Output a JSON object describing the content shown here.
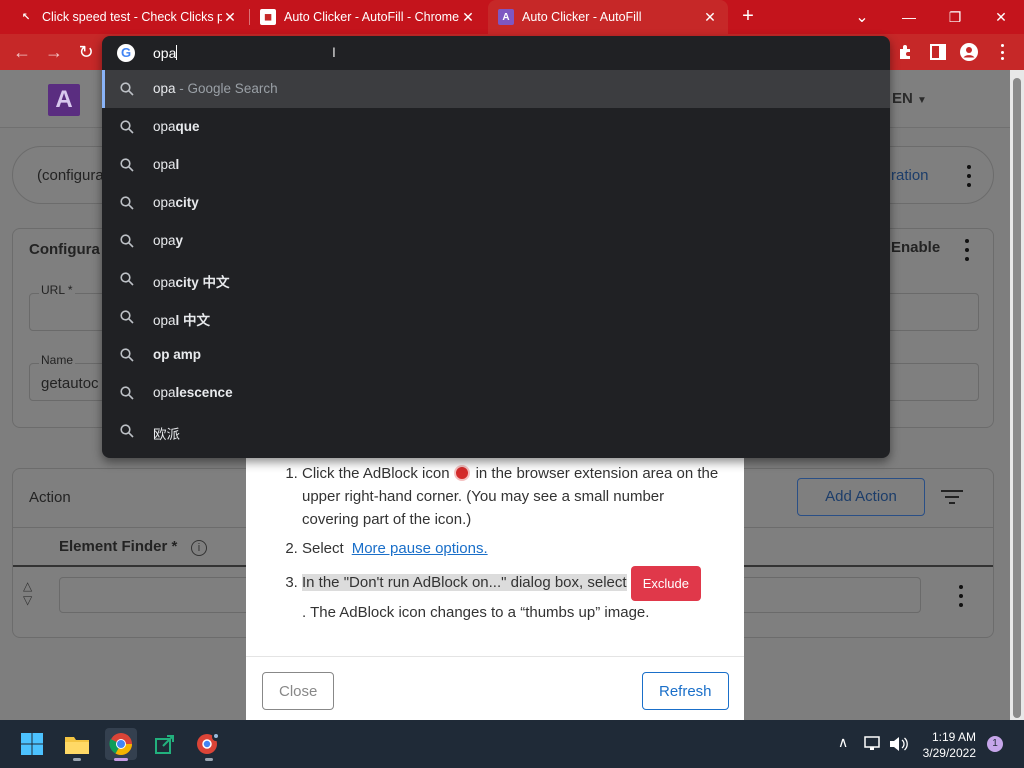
{
  "browser": {
    "tabs": [
      {
        "title": "Click speed test - Check Clicks pe",
        "active": false
      },
      {
        "title": "Auto Clicker - AutoFill - Chrome",
        "active": false
      },
      {
        "title": "Auto Clicker - AutoFill",
        "active": true
      }
    ],
    "new_tab_label": "+",
    "window_controls": {
      "minimize": "—",
      "restore": "❐",
      "close": "✕",
      "tab_search": "⌄"
    }
  },
  "omnibox": {
    "query": "opa",
    "suggestions": [
      {
        "typed": "opa",
        "completion": "",
        "hint": " - Google Search",
        "selected": true
      },
      {
        "typed": "opa",
        "completion": "que",
        "hint": ""
      },
      {
        "typed": "opa",
        "completion": "l",
        "hint": ""
      },
      {
        "typed": "opa",
        "completion": "city",
        "hint": ""
      },
      {
        "typed": "opa",
        "completion": "y",
        "hint": ""
      },
      {
        "typed": "opa",
        "completion": "city 中文",
        "hint": ""
      },
      {
        "typed": "opa",
        "completion": "l 中文",
        "hint": ""
      },
      {
        "typed": "",
        "completion": "op amp",
        "hint": ""
      },
      {
        "typed": "opa",
        "completion": "lescence",
        "hint": ""
      },
      {
        "typed": "欧派",
        "completion": "",
        "hint": ""
      }
    ]
  },
  "app": {
    "logo_letter": "A",
    "language": "EN",
    "configuration_select": "(configura",
    "configuration_link": "ration",
    "config_card_title": "Configura",
    "enable_label": "Enable",
    "url_label": "URL *",
    "name_label": "Name",
    "name_value": "getautoc",
    "action_title": "Action",
    "add_action_label": "Add Action",
    "element_finder_label": "Element Finder *"
  },
  "modal": {
    "step1_before": "Click the AdBlock icon",
    "step1_after": "in the browser extension area on the upper right-hand corner. (You may see a small number covering part of the icon.)",
    "step2_before": "Select",
    "step2_link": "More pause options.",
    "step3_before": "In the \"Don't run AdBlock on...\" dialog box, select",
    "step3_button": "Exclude",
    "step3_after": ". The AdBlock icon changes to a “thumbs up” image.",
    "close_label": "Close",
    "refresh_label": "Refresh"
  },
  "taskbar": {
    "time": "1:19 AM",
    "date": "3/29/2022",
    "notification_count": "1"
  },
  "colors": {
    "chrome_frame": "#c62828",
    "omnibox_bg": "#202124",
    "accent_blue": "#1a6fc9",
    "exclude_red": "#e0384a"
  }
}
